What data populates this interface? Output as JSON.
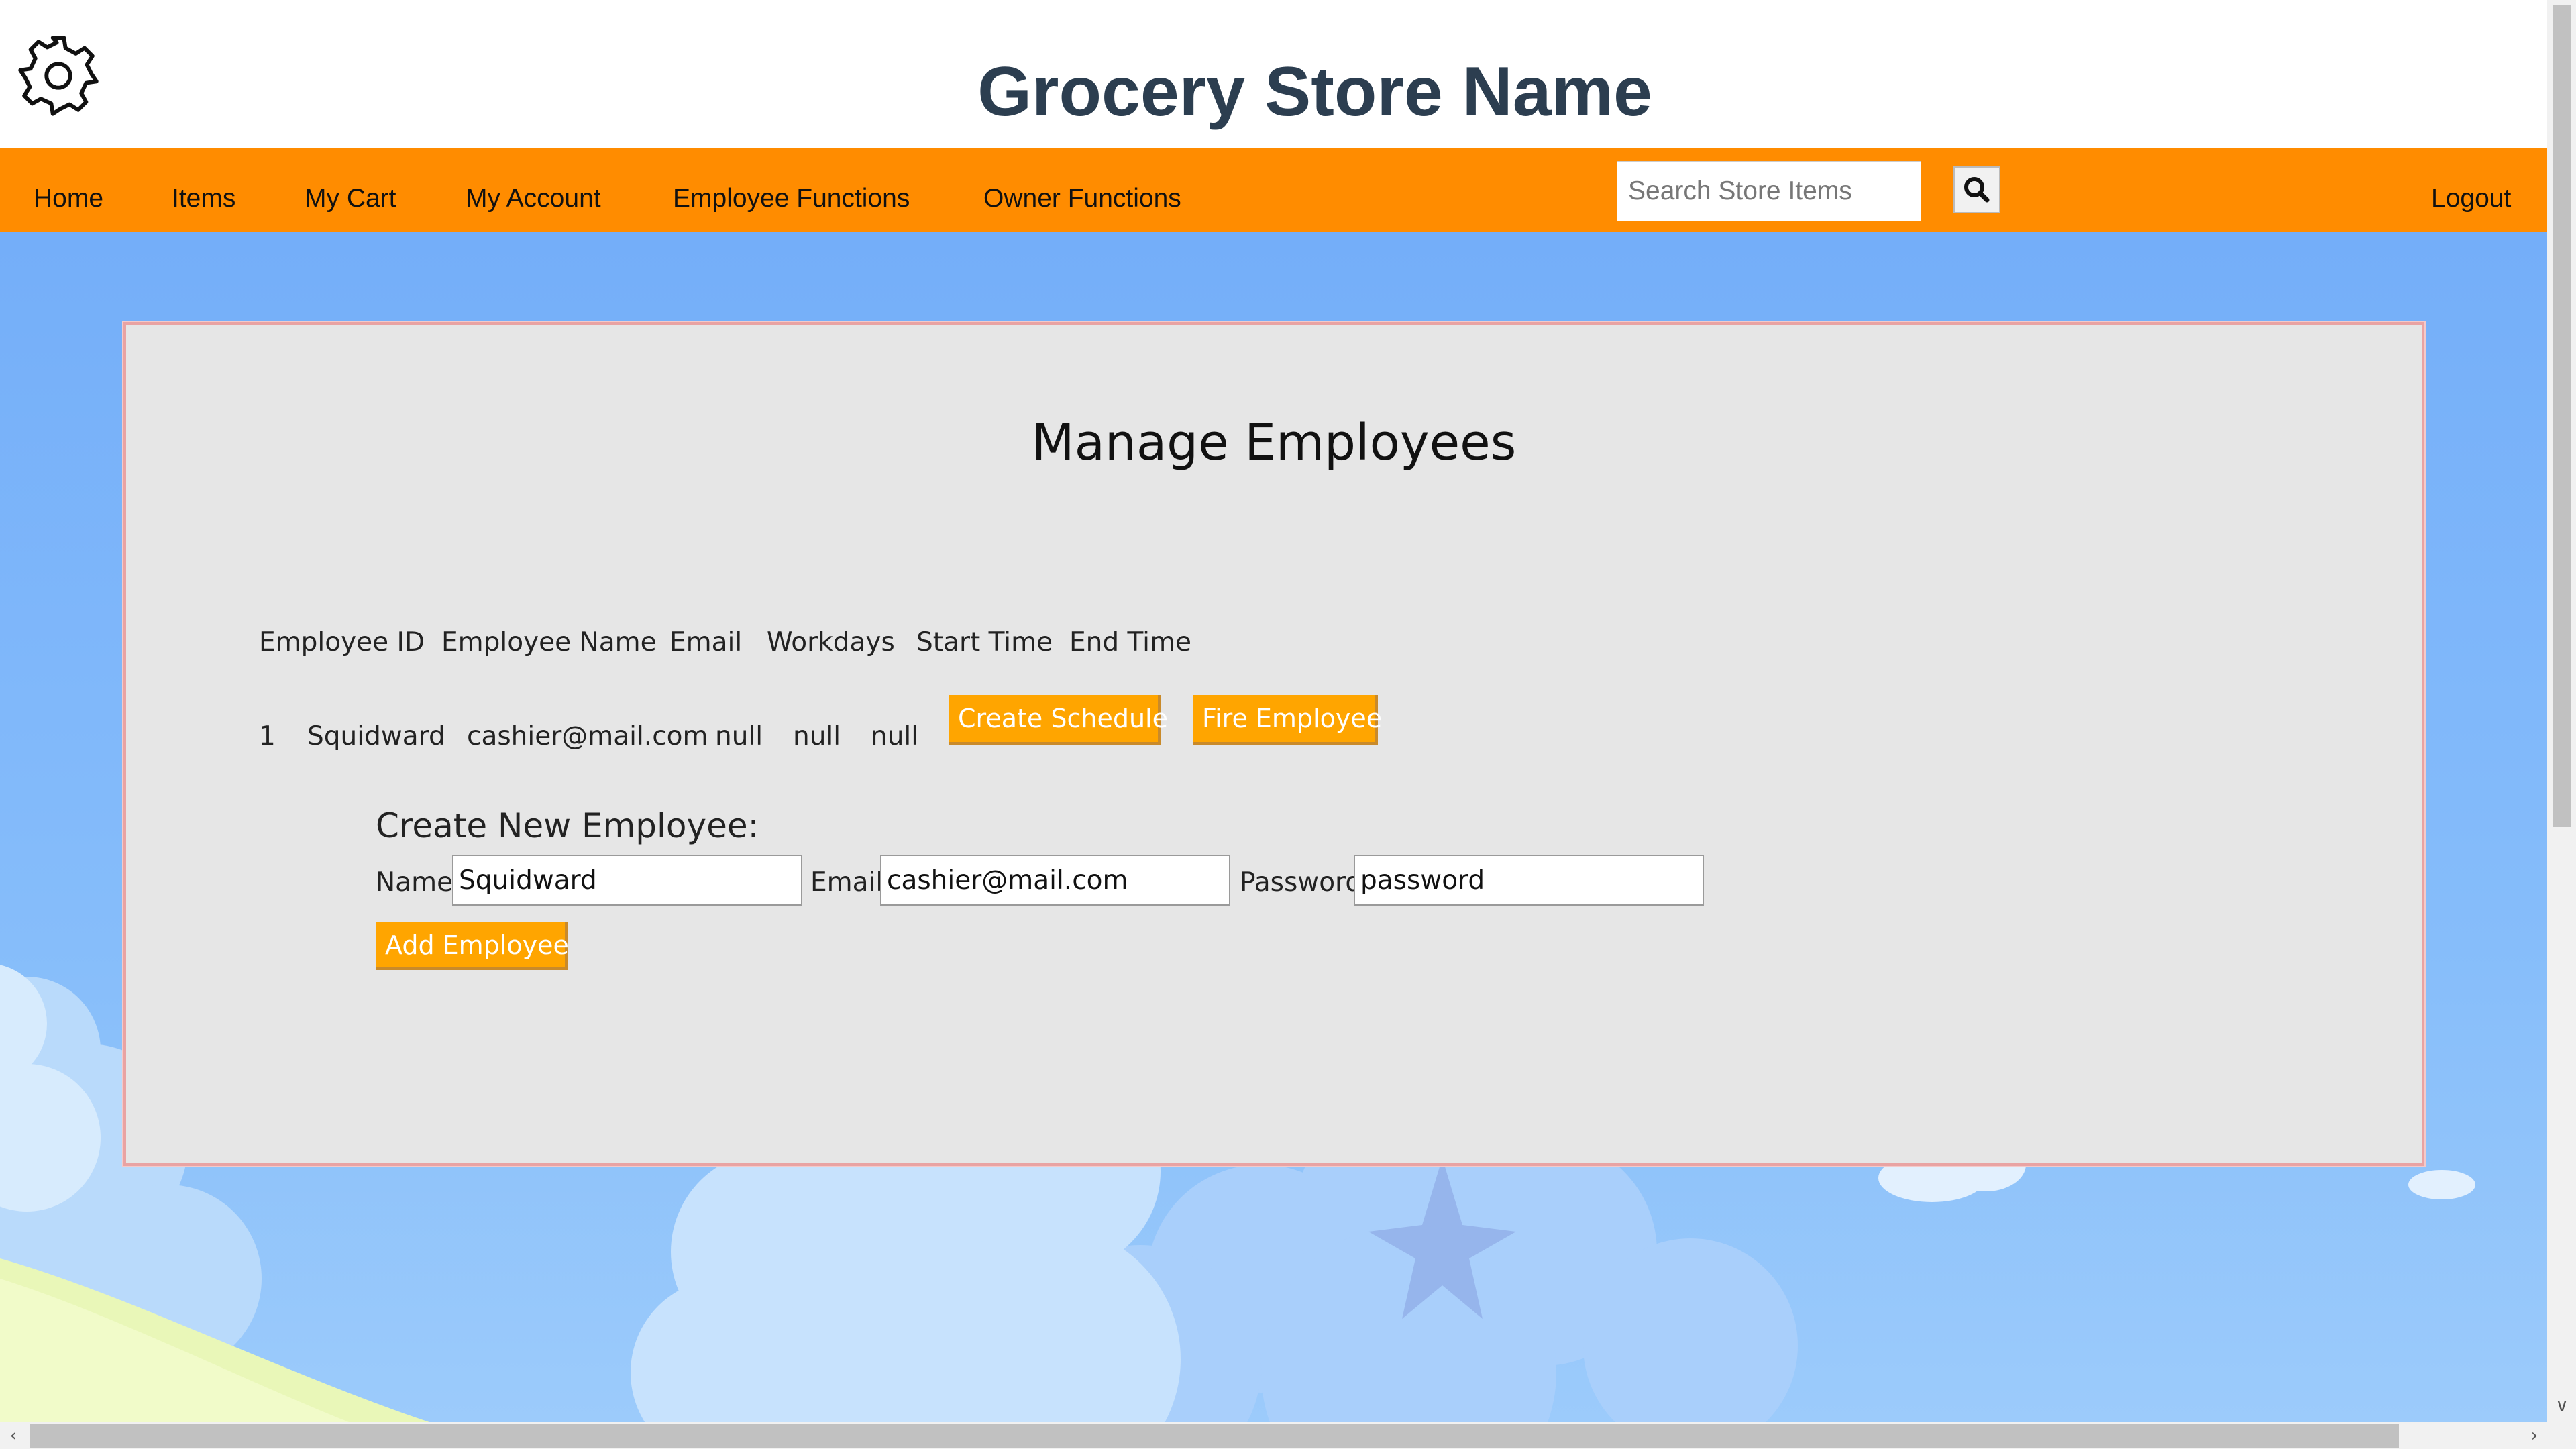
{
  "header": {
    "title": "Grocery Store Name",
    "settings_icon": "gear-icon"
  },
  "nav": {
    "links": [
      {
        "label": "Home"
      },
      {
        "label": "Items"
      },
      {
        "label": "My Cart"
      },
      {
        "label": "My Account"
      },
      {
        "label": "Employee Functions"
      },
      {
        "label": "Owner Functions"
      }
    ],
    "search_placeholder": "Search Store Items",
    "search_icon": "search-icon",
    "logout_label": "Logout"
  },
  "page": {
    "title": "Manage Employees",
    "table": {
      "headers": [
        "Employee ID",
        "Employee Name",
        "Email",
        "Workdays",
        "Start Time",
        "End Time"
      ],
      "rows": [
        {
          "id": "1",
          "name": "Squidward",
          "email": "cashier@mail.com",
          "workdays": "null",
          "start_time": "null",
          "end_time": "null",
          "create_schedule_label": "Create Schedule",
          "fire_label": "Fire Employee"
        }
      ]
    },
    "create_form": {
      "heading": "Create New Employee:",
      "name_label": "Name",
      "name_value": "Squidward",
      "email_label": "Email",
      "email_value": "cashier@mail.com",
      "password_label": "Password",
      "password_value": "password",
      "submit_label": "Add Employee"
    }
  },
  "colors": {
    "nav_bg": "#ff8c00",
    "button_bg": "#ffa500",
    "title_color": "#2c3e50",
    "panel_bg": "#e6e6e6",
    "sky": "#74aef9"
  }
}
